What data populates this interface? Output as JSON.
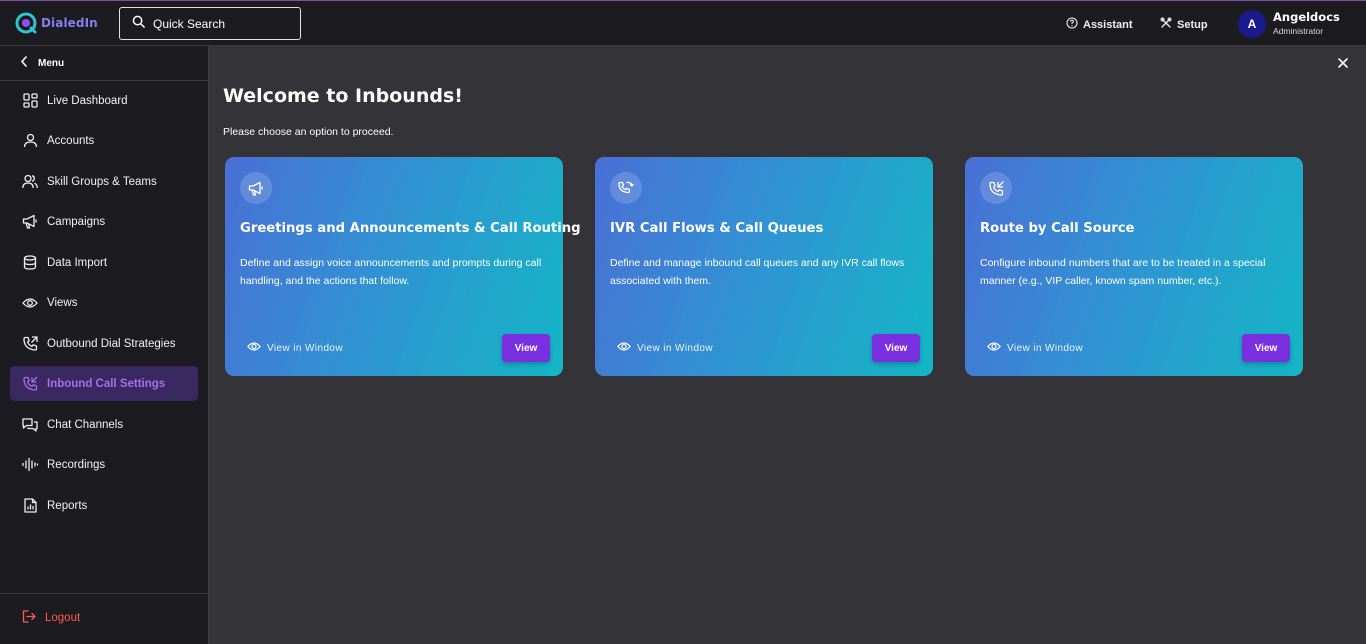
{
  "app": {
    "name": "DialedIn"
  },
  "search": {
    "label": "Quick Search"
  },
  "header": {
    "assistant_label": "Assistant",
    "setup_label": "Setup",
    "user": {
      "initial": "A",
      "name": "Angeldocs",
      "role": "Administrator"
    }
  },
  "sidebar": {
    "menu_label": "Menu",
    "items": [
      {
        "label": "Live Dashboard",
        "icon": "dashboard-icon"
      },
      {
        "label": "Accounts",
        "icon": "user-icon"
      },
      {
        "label": "Skill Groups & Teams",
        "icon": "users-icon"
      },
      {
        "label": "Campaigns",
        "icon": "megaphone-icon"
      },
      {
        "label": "Data Import",
        "icon": "database-icon"
      },
      {
        "label": "Views",
        "icon": "eye-icon"
      },
      {
        "label": "Outbound Dial Strategies",
        "icon": "phone-outgoing-icon"
      },
      {
        "label": "Inbound Call Settings",
        "icon": "phone-incoming-icon",
        "active": true
      },
      {
        "label": "Chat Channels",
        "icon": "chat-icon"
      },
      {
        "label": "Recordings",
        "icon": "waveform-icon"
      },
      {
        "label": "Reports",
        "icon": "report-icon"
      }
    ],
    "logout_label": "Logout"
  },
  "main": {
    "title": "Welcome to Inbounds!",
    "subtitle": "Please choose an option to proceed.",
    "cards": [
      {
        "icon": "megaphone-icon",
        "title": "Greetings and Announcements & Call Routing",
        "description": "Define and assign voice announcements and prompts during call handling, and the actions that follow.",
        "view_window_label": "View in Window",
        "view_label": "View"
      },
      {
        "icon": "phone-flow-icon",
        "title": "IVR Call Flows & Call Queues",
        "description": "Define and manage inbound call queues and any IVR call flows associated with them.",
        "view_window_label": "View in Window",
        "view_label": "View"
      },
      {
        "icon": "phone-incoming-icon",
        "title": "Route by Call Source",
        "description": "Configure inbound numbers that are to be treated in a special manner (e.g., VIP caller, known spam number, etc.).",
        "view_window_label": "View in Window",
        "view_label": "View"
      }
    ]
  },
  "colors": {
    "accent": "#7a2fe0",
    "active_text": "#a86ee8",
    "logout": "#ff5a52",
    "card_gradient_start": "#4a6fd6",
    "card_gradient_end": "#14b6c6"
  }
}
